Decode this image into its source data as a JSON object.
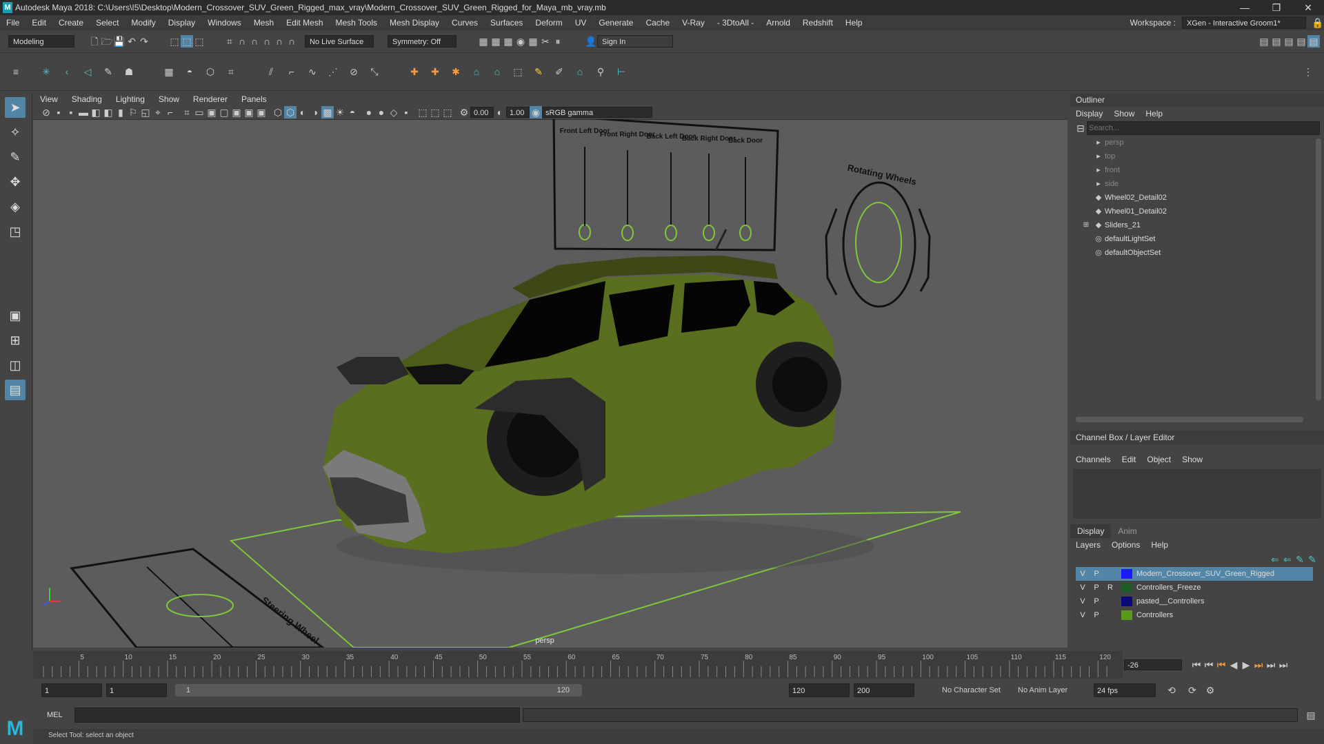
{
  "app": {
    "title": "Autodesk Maya 2018: C:\\Users\\I5\\Desktop\\Modern_Crossover_SUV_Green_Rigged_max_vray\\Modern_Crossover_SUV_Green_Rigged_for_Maya_mb_vray.mb",
    "logo_letter": "M"
  },
  "window_controls": {
    "minimize": "—",
    "maximize": "❐",
    "close": "✕"
  },
  "menu": [
    "File",
    "Edit",
    "Create",
    "Select",
    "Modify",
    "Display",
    "Windows",
    "Mesh",
    "Edit Mesh",
    "Mesh Tools",
    "Mesh Display",
    "Curves",
    "Surfaces",
    "Deform",
    "UV",
    "Generate",
    "Cache",
    "V-Ray",
    "- 3DtoAll -",
    "Arnold",
    "Redshift",
    "Help"
  ],
  "workspace": {
    "label": "Workspace :",
    "value": "XGen - Interactive Groom1*"
  },
  "status": {
    "mode": "Modeling",
    "live_surface": "No Live Surface",
    "symmetry": "Symmetry: Off",
    "sign_in": "Sign In"
  },
  "viewport": {
    "menu": [
      "View",
      "Shading",
      "Lighting",
      "Show",
      "Renderer",
      "Panels"
    ],
    "exposure": "0.00",
    "gamma": "1.00",
    "color_space": "sRGB gamma",
    "camera_label": "persp",
    "slider_labels": [
      "Front Left Door",
      "Front Right Door",
      "Back Left Door",
      "Back Right Door",
      "Back Door"
    ],
    "wheel_label": "Rotating Wheels",
    "floor_label": "Steering Wheel"
  },
  "outliner": {
    "title": "Outliner",
    "menu": [
      "Display",
      "Show",
      "Help"
    ],
    "search_placeholder": "Search...",
    "items": [
      {
        "label": "persp",
        "dim": true
      },
      {
        "label": "top",
        "dim": true
      },
      {
        "label": "front",
        "dim": true
      },
      {
        "label": "side",
        "dim": true
      },
      {
        "label": "Wheel02_Detail02",
        "dim": false
      },
      {
        "label": "Wheel01_Detail02",
        "dim": false
      },
      {
        "label": "Sliders_21",
        "dim": false
      },
      {
        "label": "defaultLightSet",
        "dim": false
      },
      {
        "label": "defaultObjectSet",
        "dim": false
      }
    ]
  },
  "channelbox": {
    "title": "Channel Box / Layer Editor",
    "menu": [
      "Channels",
      "Edit",
      "Object",
      "Show"
    ]
  },
  "layers": {
    "tabs": [
      "Display",
      "Anim"
    ],
    "menu": [
      "Layers",
      "Options",
      "Help"
    ],
    "rows": [
      {
        "v": "V",
        "p": "P",
        "r": "",
        "color": "#1a1aff",
        "name": "Modern_Crossover_SUV_Green_Rigged",
        "selected": true
      },
      {
        "v": "V",
        "p": "P",
        "r": "R",
        "color": "#1f5c2a",
        "name": "Controllers_Freeze",
        "selected": false
      },
      {
        "v": "V",
        "p": "P",
        "r": "",
        "color": "#0a0a7a",
        "name": "pasted__Controllers",
        "selected": false
      },
      {
        "v": "V",
        "p": "P",
        "r": "",
        "color": "#5a9a1a",
        "name": "Controllers",
        "selected": false
      }
    ]
  },
  "timeline": {
    "ticks": [
      "5",
      "10",
      "15",
      "20",
      "25",
      "30",
      "35",
      "40",
      "45",
      "50",
      "55",
      "60",
      "65",
      "70",
      "75",
      "80",
      "85",
      "90",
      "95",
      "100",
      "105",
      "110",
      "115",
      "120"
    ],
    "current_frame": "-26"
  },
  "range": {
    "start": "1",
    "playback_start": "1",
    "slider_start": "1",
    "slider_end": "120",
    "playback_end": "120",
    "end": "200",
    "character_set": "No Character Set",
    "anim_layer": "No Anim Layer",
    "fps": "24 fps"
  },
  "mel": {
    "label": "MEL"
  },
  "help": {
    "text": "Select Tool: select an object"
  }
}
